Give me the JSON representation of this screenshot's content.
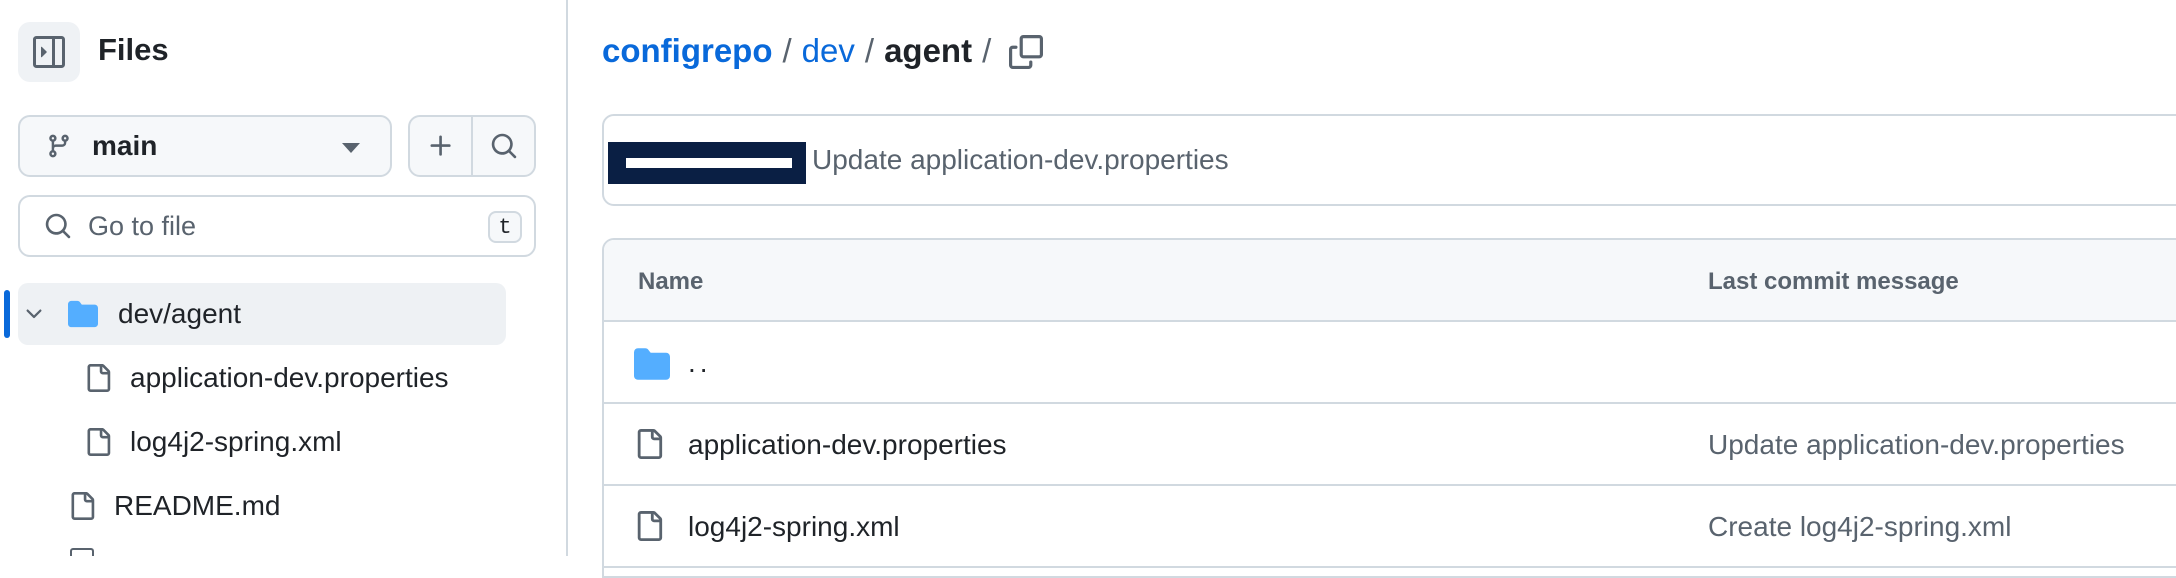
{
  "sidebar": {
    "title": "Files",
    "branch": "main",
    "search_placeholder": "Go to file",
    "shortcut_key": "t",
    "tree": [
      {
        "label": "dev/agent",
        "type": "folder",
        "expanded": true,
        "active": true
      },
      {
        "label": "application-dev.properties",
        "type": "file"
      },
      {
        "label": "log4j2-spring.xml",
        "type": "file"
      },
      {
        "label": "README.md",
        "type": "file"
      }
    ]
  },
  "breadcrumb": {
    "repo": "configrepo",
    "dir": "dev",
    "current": "agent",
    "separator": "/"
  },
  "latest_commit": {
    "message": "Update application-dev.properties"
  },
  "table": {
    "headers": {
      "name": "Name",
      "message": "Last commit message"
    },
    "parent": "..",
    "rows": [
      {
        "name": "application-dev.properties",
        "message": "Update application-dev.properties"
      },
      {
        "name": "log4j2-spring.xml",
        "message": "Create log4j2-spring.xml"
      }
    ]
  },
  "colors": {
    "accent": "#0969da",
    "folder": "#54aeff",
    "border": "#d1d9e0",
    "muted": "#59636e"
  }
}
